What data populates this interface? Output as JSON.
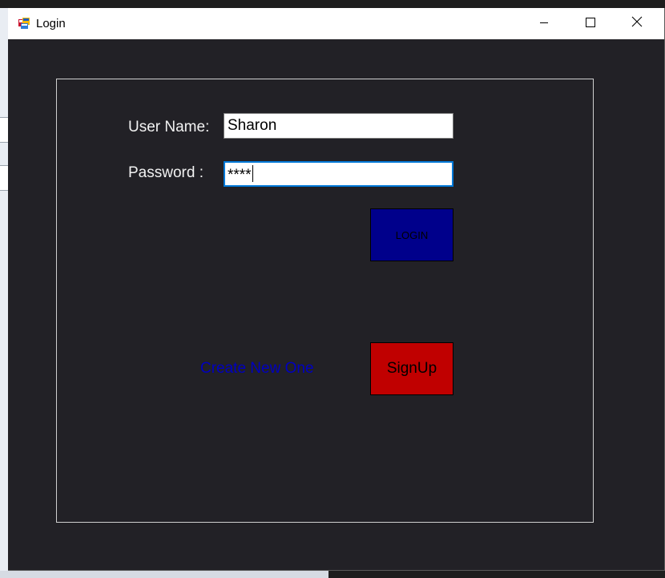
{
  "window": {
    "title": "Login",
    "app_icon": "windows-forms-app-icon",
    "controls": {
      "minimize_icon": "minimize-icon",
      "maximize_icon": "maximize-icon",
      "close_icon": "close-icon"
    }
  },
  "form": {
    "username_label": "User Name:",
    "username_value": "Sharon",
    "password_label": "Password :",
    "password_value": "****",
    "login_label": "LOGIN",
    "create_link_text": "Create New One",
    "signup_label": "SignUp"
  },
  "colors": {
    "form_background": "#222126",
    "login_button": "#00008b",
    "signup_button": "#c00000",
    "link": "#0000c0",
    "focus_border": "#0078d7"
  }
}
